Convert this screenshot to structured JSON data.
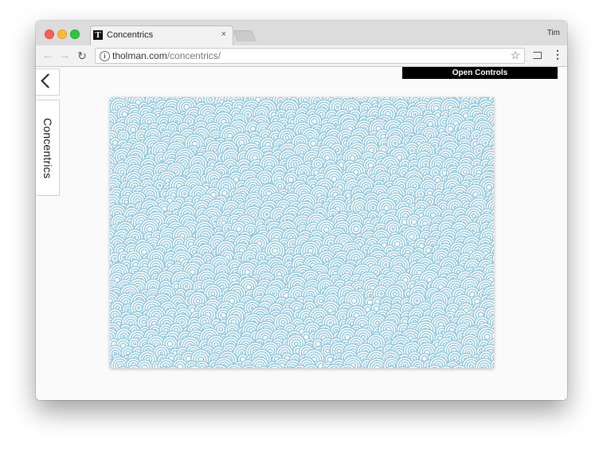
{
  "browser": {
    "tab_title": "Concentrics",
    "tab_close_label": "×",
    "favicon_letter": "T",
    "profile_name": "Tim",
    "url_host": "tholman.com",
    "url_path": "/concentrics/"
  },
  "page": {
    "back_icon": "chevron-left-icon",
    "project_title": "Concentrics",
    "open_controls_label": "Open Controls",
    "canvas_pattern_color": "#94c8dc",
    "canvas_background": "#ffffff"
  },
  "colors": {
    "close_light": "#fc5f57",
    "minimize_light": "#fdbc2e",
    "zoom_light": "#28c840"
  }
}
